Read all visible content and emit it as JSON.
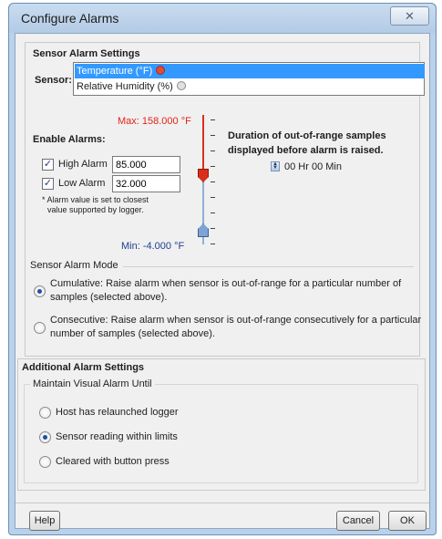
{
  "window": {
    "title": "Configure Alarms",
    "close_glyph": "✕"
  },
  "sensor_section": {
    "heading": "Sensor Alarm Settings",
    "sensor_label": "Sensor:",
    "sensors": [
      {
        "label": "Temperature (°F)",
        "selected": true,
        "icon": "alarm-clock-red-icon"
      },
      {
        "label": "Relative Humidity (%)",
        "selected": false,
        "icon": "alarm-clock-grey-icon"
      }
    ],
    "max_label": "Max: 158.000 °F",
    "min_label": "Min: -4.000 °F",
    "enable_alarms_label": "Enable Alarms:",
    "high_alarm": {
      "label": "High Alarm",
      "checked": true,
      "value": "85.000"
    },
    "low_alarm": {
      "label": "Low Alarm",
      "checked": true,
      "value": "32.000"
    },
    "note_line1": "* Alarm value is set to closest",
    "note_line2": "value supported by logger.",
    "duration_line1": "Duration of out-of-range samples",
    "duration_line2": "displayed before alarm is raised.",
    "duration_value": "00 Hr 00 Min",
    "mode_title": "Sensor Alarm Mode",
    "mode_options": [
      {
        "line1": "Cumulative: Raise alarm when sensor is out-of-range for a particular number of",
        "line2": "samples (selected above).",
        "selected": true
      },
      {
        "line1": "Consecutive: Raise alarm when sensor is out-of-range consecutively for a particular",
        "line2": "number of samples (selected above).",
        "selected": false
      }
    ]
  },
  "additional_section": {
    "heading": "Additional Alarm Settings",
    "group_title": "Maintain Visual Alarm Until",
    "options": [
      {
        "label": "Host has relaunched logger",
        "selected": false
      },
      {
        "label": "Sensor reading within limits",
        "selected": true
      },
      {
        "label": "Cleared with button press",
        "selected": false
      }
    ]
  },
  "footer": {
    "help_label": "Help",
    "cancel_label": "Cancel",
    "ok_label": "OK"
  },
  "colors": {
    "max_red": "#e0241a",
    "min_blue": "#1f3f8f",
    "selection": "#3399ff"
  }
}
